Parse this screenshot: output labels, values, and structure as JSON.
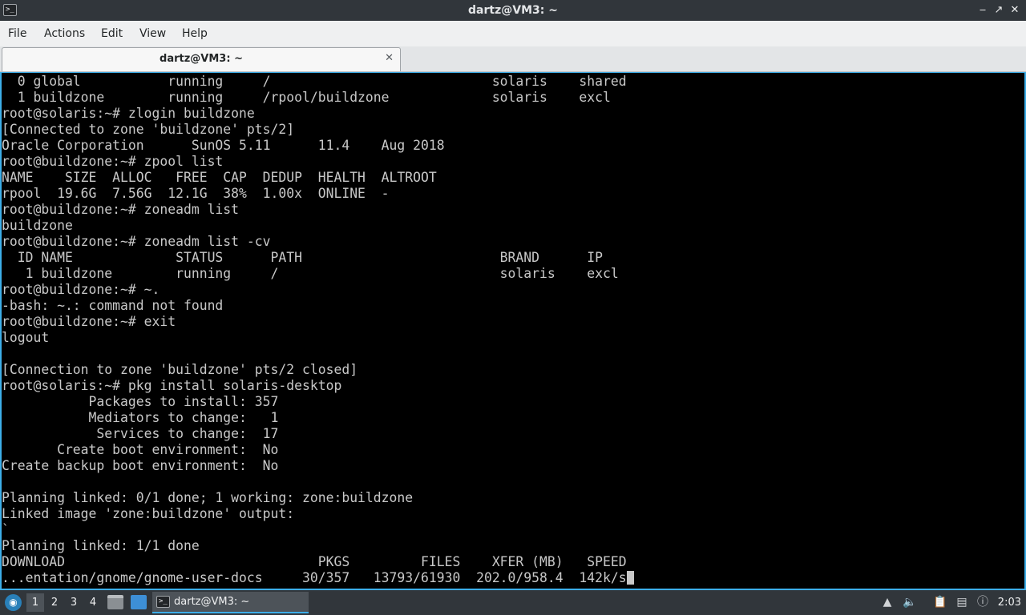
{
  "window": {
    "title": "dartz@VM3: ~",
    "controls": {
      "minimize": "‒",
      "maximize": "↗",
      "close": "✕"
    }
  },
  "menu": {
    "items": [
      "File",
      "Actions",
      "Edit",
      "View",
      "Help"
    ]
  },
  "tabs": [
    {
      "label": "dartz@VM3: ~",
      "close": "✕"
    }
  ],
  "terminal": {
    "lines": [
      "  0 global           running     /                            solaris    shared",
      "  1 buildzone        running     /rpool/buildzone             solaris    excl",
      "root@solaris:~# zlogin buildzone",
      "[Connected to zone 'buildzone' pts/2]",
      "Oracle Corporation      SunOS 5.11      11.4    Aug 2018",
      "root@buildzone:~# zpool list",
      "NAME    SIZE  ALLOC   FREE  CAP  DEDUP  HEALTH  ALTROOT",
      "rpool  19.6G  7.56G  12.1G  38%  1.00x  ONLINE  -",
      "root@buildzone:~# zoneadm list",
      "buildzone",
      "root@buildzone:~# zoneadm list -cv",
      "  ID NAME             STATUS      PATH                         BRAND      IP",
      "   1 buildzone        running     /                            solaris    excl",
      "root@buildzone:~# ~.",
      "-bash: ~.: command not found",
      "root@buildzone:~# exit",
      "logout",
      "",
      "[Connection to zone 'buildzone' pts/2 closed]",
      "root@solaris:~# pkg install solaris-desktop",
      "           Packages to install: 357",
      "           Mediators to change:   1",
      "            Services to change:  17",
      "       Create boot environment:  No",
      "Create backup boot environment:  No",
      "",
      "Planning linked: 0/1 done; 1 working: zone:buildzone",
      "Linked image 'zone:buildzone' output:",
      "`",
      "Planning linked: 1/1 done",
      "DOWNLOAD                                PKGS         FILES    XFER (MB)   SPEED"
    ],
    "current_line": "...entation/gnome/gnome-user-docs     30/357   13793/61930  202.0/958.4  142k/s"
  },
  "taskbar": {
    "workspaces": [
      "1",
      "2",
      "3",
      "4"
    ],
    "active_workspace": "1",
    "task_label": "dartz@VM3: ~",
    "clock": "2:03"
  },
  "colors": {
    "terminal_bg": "#000000",
    "terminal_fg": "#c8c8c8",
    "focus_border": "#3daee9",
    "titlebar_bg": "#31363b",
    "menubar_bg": "#eff0f1"
  }
}
